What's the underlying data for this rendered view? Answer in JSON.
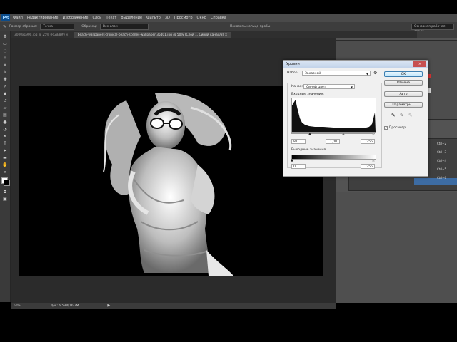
{
  "menu": {
    "logo": "Ps",
    "items": [
      "Файл",
      "Редактирование",
      "Изображение",
      "Слои",
      "Текст",
      "Выделение",
      "Фильтр",
      "3D",
      "Просмотр",
      "Окно",
      "Справка"
    ]
  },
  "options": {
    "size_label": "Размер образца:",
    "size_value": "Точка",
    "sample_label": "Образец:",
    "sample_value": "Все слои",
    "show_ring": "Показать кольцо пробы",
    "workspace": "Основная рабочая среда"
  },
  "tabs": [
    {
      "label": "3000x1900.jpg @ 25% (RGB/8#) ×",
      "active": false
    },
    {
      "label": "beach-wallpapers-tropical-beach-scenes-wallpaper-35401.jpg @ 50% (Слой 1, Синий канал/8) ×",
      "active": true
    }
  ],
  "status": {
    "zoom": "50%",
    "doc": "Док: 6,59М/16,3М"
  },
  "shortcuts": [
    "Ctrl+2",
    "Ctrl+3",
    "Ctrl+4",
    "Ctrl+5",
    "Ctrl+6"
  ],
  "dialog": {
    "title": "Уровни",
    "close": "×",
    "preset_label": "Набор:",
    "preset_value": "Заказной",
    "channel_label": "Канал:",
    "channel_value": "Синий цвет",
    "input_label": "Входные значения:",
    "input_black": "81",
    "input_gamma": "1,00",
    "input_white": "255",
    "output_label": "Выходные значения:",
    "output_black": "0",
    "output_white": "255",
    "buttons": {
      "ok": "OK",
      "cancel": "Отмена",
      "auto": "Авто",
      "options": "Параметры..."
    },
    "preview_label": "Просмотр",
    "preview_check": "✓"
  },
  "colors": {
    "accent": "#3c7fb1",
    "panel": "#535353"
  }
}
